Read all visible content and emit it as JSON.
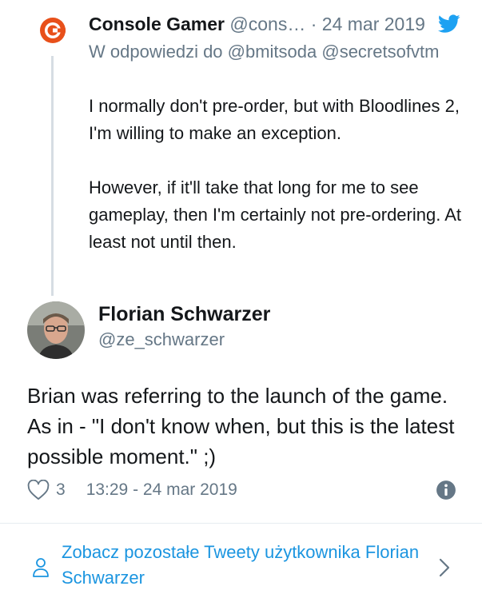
{
  "reply_tweet": {
    "name": "Console Gamer",
    "handle": "@cons…",
    "separator": "·",
    "date": "24 mar 2019",
    "replying_to": "W odpowiedzi do @bmitsoda @secretsofvtm",
    "text": "I normally don't pre-order, but with Bloodlines 2, I'm willing to make an exception.\n\nHowever, if it'll take that long for me to see gameplay, then I'm certainly not pre-ordering. At least not until then."
  },
  "main_tweet": {
    "name": "Florian Schwarzer",
    "handle": "@ze_schwarzer",
    "text": "Brian was referring to the launch of the game. As in - \"I don't know when, but this is the latest possible moment.\" ;)",
    "likes": "3",
    "timestamp": "13:29 - 24 mar 2019"
  },
  "more_tweets": {
    "label": "Zobacz pozostałe Tweety użytkownika Florian Schwarzer"
  },
  "icons": {
    "brand": "twitter-bird-icon",
    "like": "heart-icon",
    "info": "info-icon",
    "user": "user-icon",
    "chevron": "chevron-right-icon"
  },
  "colors": {
    "twitter_blue": "#1da1f2",
    "link_blue": "#1b95e0",
    "secondary_text": "#657786",
    "console_gamer_orange": "#e8501a"
  }
}
